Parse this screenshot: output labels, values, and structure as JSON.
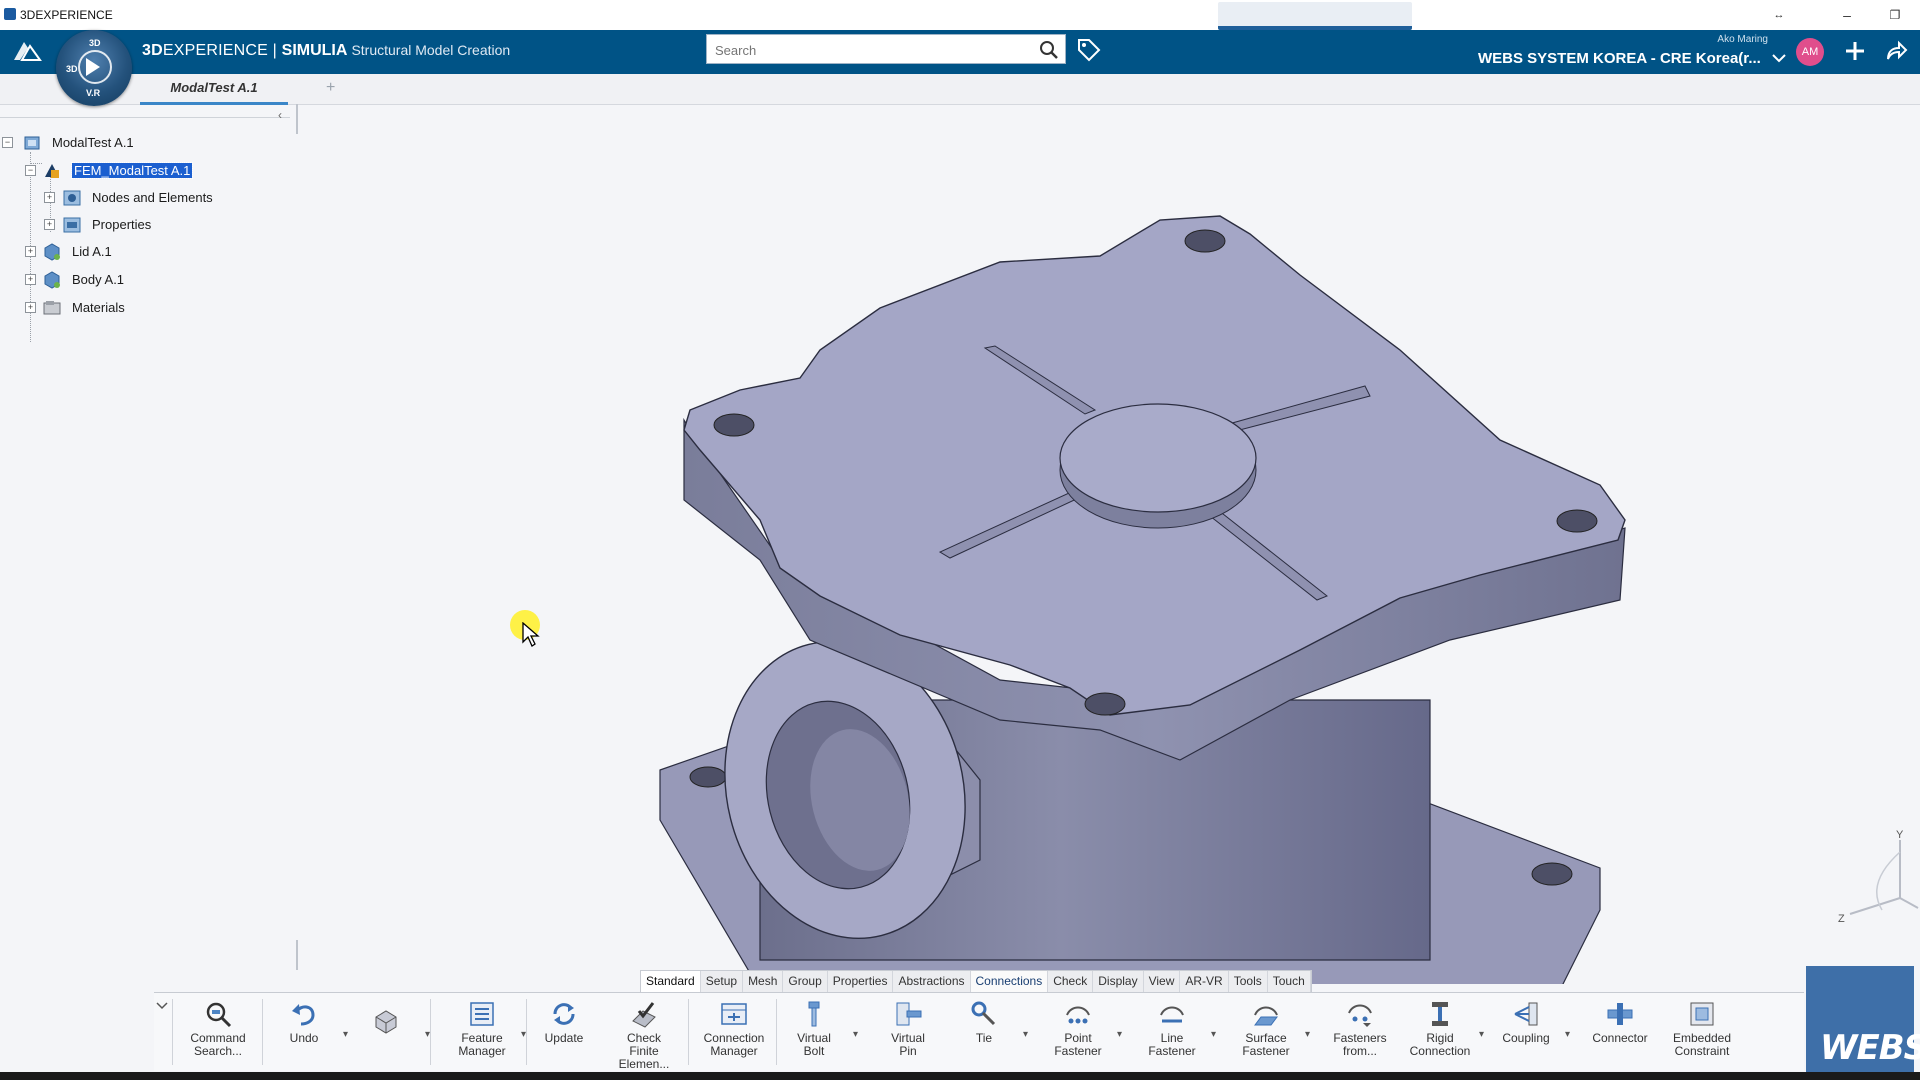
{
  "window": {
    "title": "3DEXPERIENCE",
    "controls": {
      "minimize": "–",
      "maximize": "❐",
      "resize": "↔"
    }
  },
  "header": {
    "brand_3d": "3D",
    "brand_experience": "EXPERIENCE",
    "brand_separator": " | ",
    "brand_product": "SIMULIA",
    "brand_app": "Structural Model Creation",
    "compass": {
      "top": "3D",
      "bottom": "V.R",
      "left": "3D"
    },
    "search_placeholder": "Search",
    "user_name": "Ako Maring",
    "tenant": "WEBS SYSTEM KOREA - CRE Korea(r...",
    "avatar_initials": "AM"
  },
  "tabs": {
    "active": "ModalTest A.1",
    "add": "+"
  },
  "tree_panel": {
    "collapse": "‹"
  },
  "tree": [
    {
      "label": "ModalTest A.1",
      "expanded": true,
      "icon": "product-icon"
    },
    {
      "label": "FEM_ModalTest A.1",
      "expanded": true,
      "selected": true,
      "icon": "fem-icon"
    },
    {
      "label": "Nodes and Elements",
      "expanded": false,
      "icon": "nodes-icon"
    },
    {
      "label": "Properties",
      "expanded": false,
      "icon": "properties-icon"
    },
    {
      "label": "Lid A.1",
      "expanded": false,
      "icon": "part-icon"
    },
    {
      "label": "Body A.1",
      "expanded": false,
      "icon": "part-icon"
    },
    {
      "label": "Materials",
      "expanded": false,
      "icon": "materials-icon"
    }
  ],
  "actionbar_tabs": [
    "Standard",
    "Setup",
    "Mesh",
    "Group",
    "Properties",
    "Abstractions",
    "Connections",
    "Check",
    "Display",
    "View",
    "AR-VR",
    "Tools",
    "Touch"
  ],
  "actionbar_active": "Standard",
  "actionbar_selected": "Connections",
  "tools": [
    {
      "line1": "Command",
      "line2": "Search...",
      "icon": "command-search-icon"
    },
    {
      "line1": "Undo",
      "line2": "",
      "icon": "undo-icon"
    },
    {
      "line1": "",
      "line2": "",
      "icon": "part-select-icon"
    },
    {
      "line1": "Feature",
      "line2": "Manager",
      "icon": "feature-manager-icon"
    },
    {
      "line1": "Update",
      "line2": "",
      "icon": "update-icon"
    },
    {
      "line1": "Check",
      "line2": "Finite Elemen...",
      "icon": "check-elements-icon"
    },
    {
      "line1": "Connection",
      "line2": "Manager",
      "icon": "connection-manager-icon"
    },
    {
      "line1": "Virtual",
      "line2": "Bolt",
      "icon": "virtual-bolt-icon"
    },
    {
      "line1": "Virtual",
      "line2": "Pin",
      "icon": "virtual-pin-icon"
    },
    {
      "line1": "Tie",
      "line2": "",
      "icon": "tie-icon"
    },
    {
      "line1": "Point",
      "line2": "Fastener",
      "icon": "point-fastener-icon"
    },
    {
      "line1": "Line",
      "line2": "Fastener",
      "icon": "line-fastener-icon"
    },
    {
      "line1": "Surface",
      "line2": "Fastener",
      "icon": "surface-fastener-icon"
    },
    {
      "line1": "Fasteners",
      "line2": "from...",
      "icon": "fasteners-from-icon"
    },
    {
      "line1": "Rigid",
      "line2": "Connection",
      "icon": "rigid-connection-icon"
    },
    {
      "line1": "Coupling",
      "line2": "",
      "icon": "coupling-icon"
    },
    {
      "line1": "Connector",
      "line2": "",
      "icon": "connector-icon"
    },
    {
      "line1": "Embedded",
      "line2": "Constraint",
      "icon": "embedded-constraint-icon"
    }
  ],
  "axes": {
    "y": "Y",
    "z": "Z"
  },
  "logo": "WEBS",
  "colors": {
    "header_bg": "#005386",
    "selection": "#1b5fd0",
    "model_face": "#a0a3c4",
    "model_side": "#8a8cab",
    "logo_bg": "#3e6fa8"
  }
}
